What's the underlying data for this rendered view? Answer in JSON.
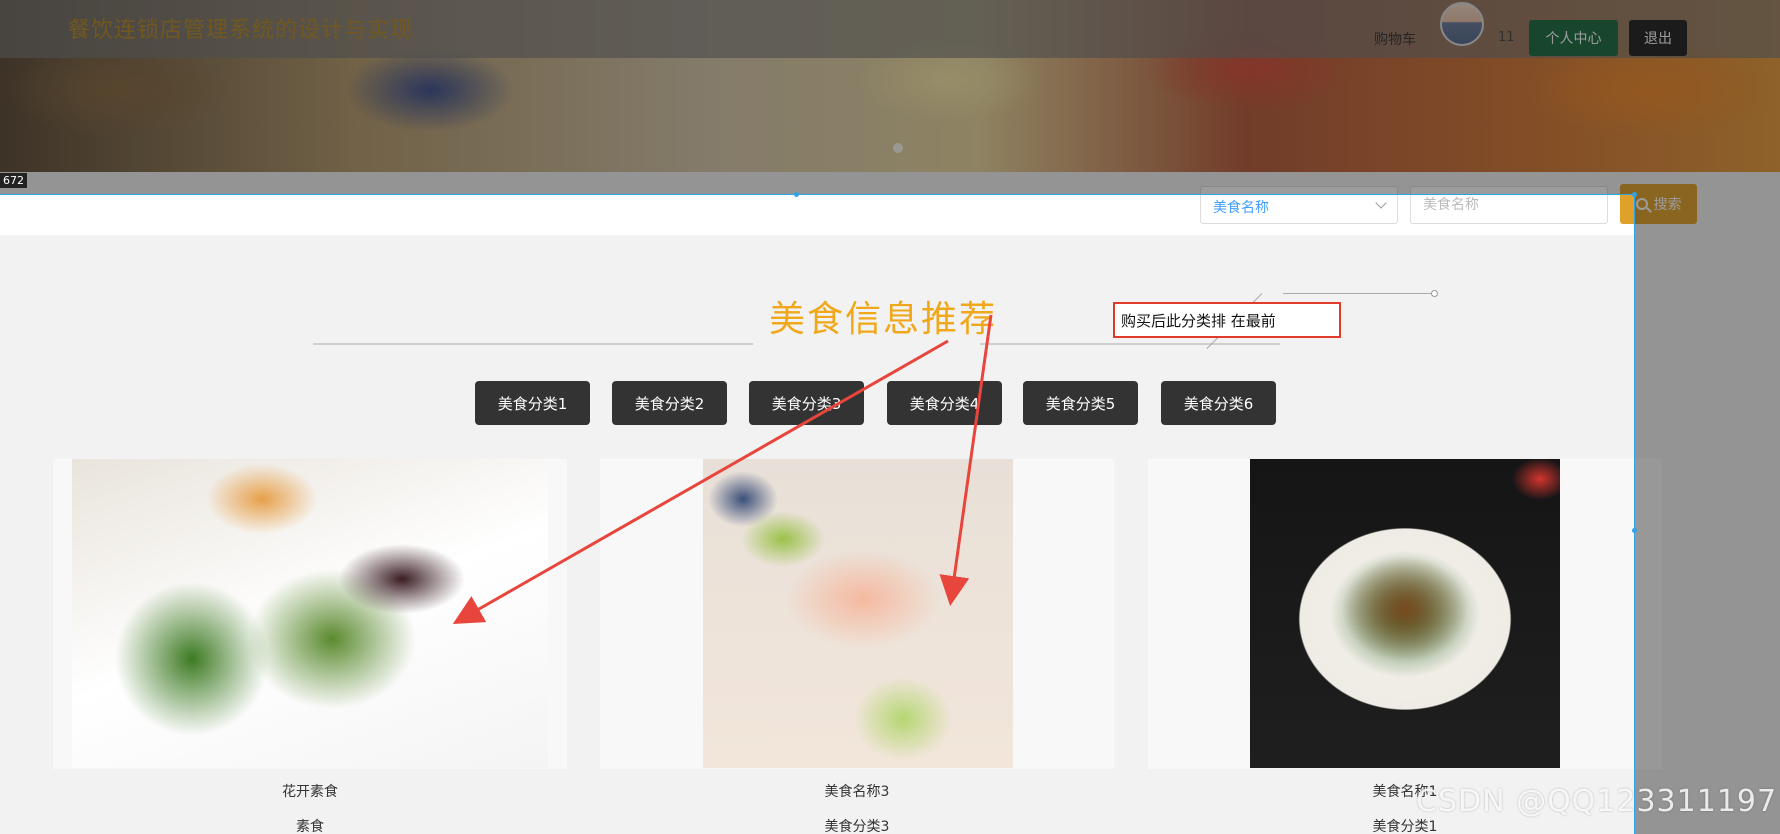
{
  "header": {
    "site_title": "餐饮连锁店管理系统的设计与实现",
    "cart_label": "购物车",
    "user_count": "11",
    "profile_button": "个人中心",
    "logout_button": "退出"
  },
  "editor_overlay": {
    "size_badge": "672"
  },
  "search": {
    "select_value": "美食名称",
    "input_placeholder": "美食名称",
    "button_label": "搜索"
  },
  "section": {
    "title": "美食信息推荐",
    "annotation": "购买后此分类排 在最前"
  },
  "categories": [
    "美食分类1",
    "美食分类2",
    "美食分类3",
    "美食分类4",
    "美食分类5",
    "美食分类6"
  ],
  "products": [
    {
      "name": "花开素食",
      "category": "素食"
    },
    {
      "name": "美食名称3",
      "category": "美食分类3"
    },
    {
      "name": "美食名称1",
      "category": "美食分类1"
    }
  ],
  "colors": {
    "accent_title": "#f0a81a",
    "profile_button": "#1c6b40",
    "logout_button": "#222222",
    "search_button": "#e0a12a",
    "annotation_border": "#e23a2a",
    "arrow": "#e8453c"
  },
  "watermark": "CSDN @QQ123311197"
}
